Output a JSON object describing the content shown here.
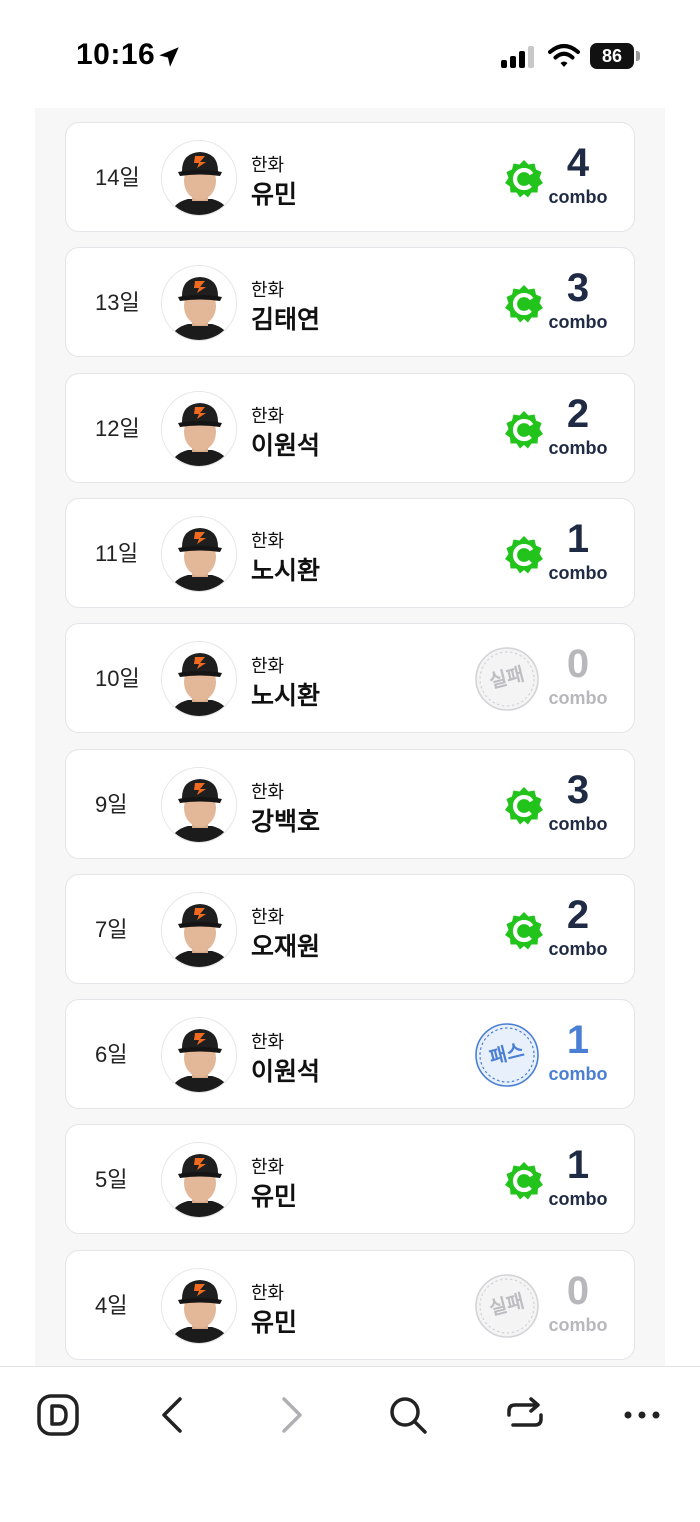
{
  "status_bar": {
    "time": "10:16",
    "battery": "86"
  },
  "list": [
    {
      "day": "14일",
      "team": "한화",
      "player": "유민",
      "status": "success",
      "combo": "4",
      "combo_label": "combo"
    },
    {
      "day": "13일",
      "team": "한화",
      "player": "김태연",
      "status": "success",
      "combo": "3",
      "combo_label": "combo"
    },
    {
      "day": "12일",
      "team": "한화",
      "player": "이원석",
      "status": "success",
      "combo": "2",
      "combo_label": "combo"
    },
    {
      "day": "11일",
      "team": "한화",
      "player": "노시환",
      "status": "success",
      "combo": "1",
      "combo_label": "combo"
    },
    {
      "day": "10일",
      "team": "한화",
      "player": "노시환",
      "status": "fail",
      "stamp_text": "실패",
      "combo": "0",
      "combo_label": "combo"
    },
    {
      "day": "9일",
      "team": "한화",
      "player": "강백호",
      "status": "success",
      "combo": "3",
      "combo_label": "combo"
    },
    {
      "day": "7일",
      "team": "한화",
      "player": "오재원",
      "status": "success",
      "combo": "2",
      "combo_label": "combo"
    },
    {
      "day": "6일",
      "team": "한화",
      "player": "이원석",
      "status": "pass",
      "stamp_text": "패스",
      "combo": "1",
      "combo_label": "combo"
    },
    {
      "day": "5일",
      "team": "한화",
      "player": "유민",
      "status": "success",
      "combo": "1",
      "combo_label": "combo"
    },
    {
      "day": "4일",
      "team": "한화",
      "player": "유민",
      "status": "fail",
      "stamp_text": "실패",
      "combo": "0",
      "combo_label": "combo"
    }
  ],
  "colors": {
    "success": "#22c31a",
    "fail": "#b8b8bc",
    "pass": "#4a7fd4",
    "combo_dark": "#1f2a44"
  },
  "toolbar": {
    "items": [
      "d-logo-icon",
      "back-icon",
      "forward-icon",
      "search-icon",
      "share-icon",
      "more-icon"
    ]
  }
}
